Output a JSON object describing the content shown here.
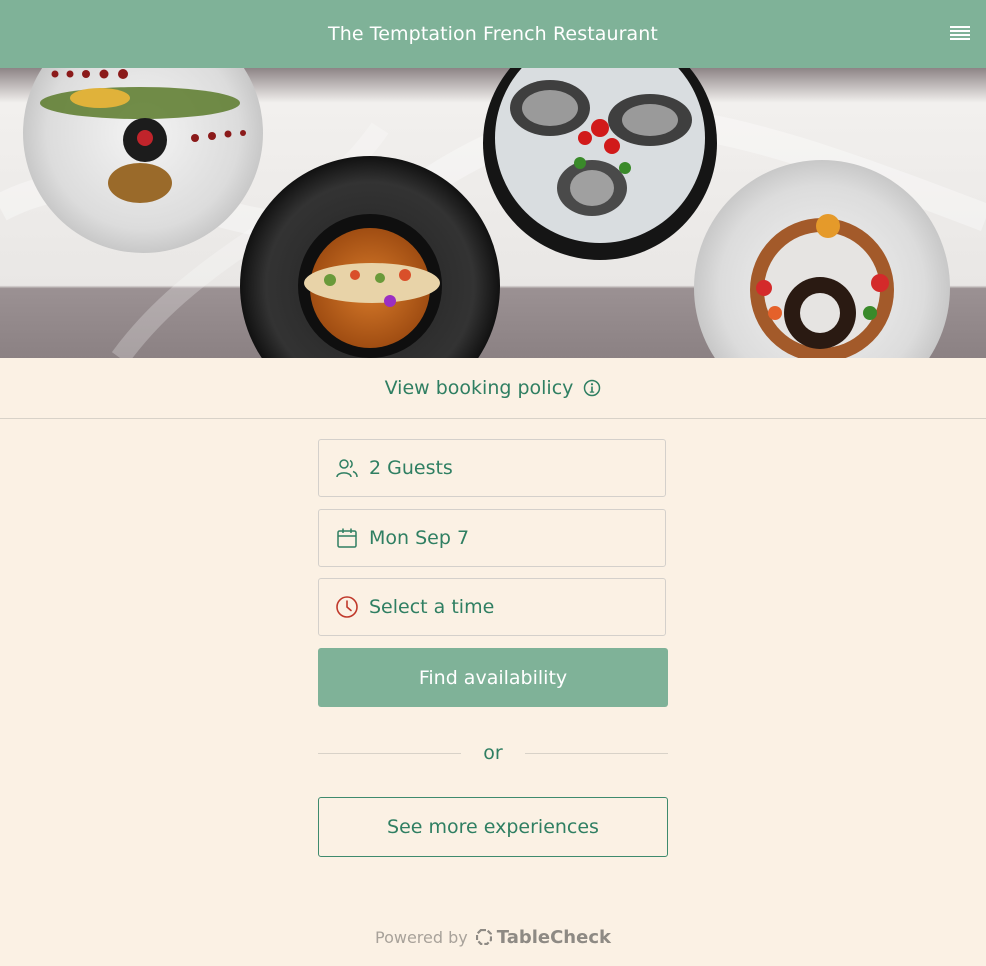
{
  "header": {
    "title": "The Temptation French Restaurant",
    "menu_icon": "hamburger-menu-icon"
  },
  "hero": {
    "description_icon": "food-plates-image"
  },
  "policy": {
    "label": "View booking policy",
    "icon": "info-icon"
  },
  "form": {
    "guests": {
      "value": "2 Guests",
      "icon": "users-icon"
    },
    "date": {
      "value": "Mon Sep 7",
      "icon": "calendar-icon"
    },
    "time": {
      "placeholder": "Select a time",
      "icon": "clock-icon"
    },
    "submit_label": "Find availability",
    "or_label": "or",
    "experiences_label": "See more experiences"
  },
  "footer": {
    "powered_by": "Powered by",
    "brand": "TableCheck"
  },
  "colors": {
    "header_bg": "#7fb298",
    "page_bg": "#fbf1e4",
    "accent_text": "#2f7f62",
    "time_icon": "#c0392b"
  }
}
